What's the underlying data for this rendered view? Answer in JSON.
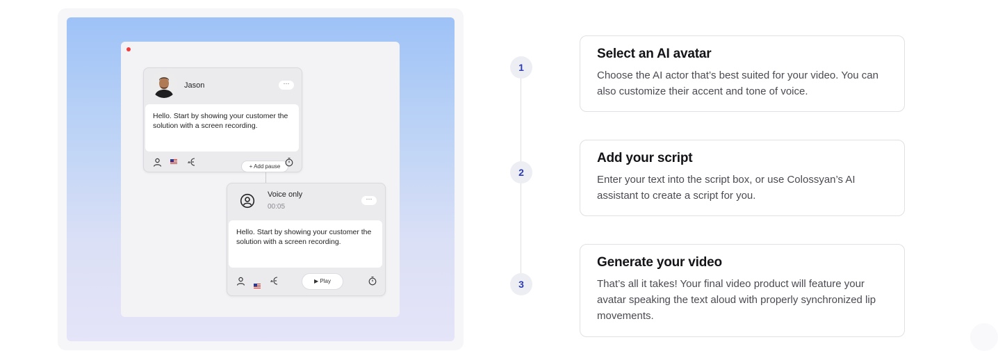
{
  "illustration": {
    "card1": {
      "name": "Jason",
      "menu_label": "···",
      "script_text": "Hello. Start by showing your customer the solution with a screen recording.",
      "add_pause_label": "+ Add pause"
    },
    "card2": {
      "name": "Voice only",
      "time": "00:05",
      "menu_label": "···",
      "script_text": "Hello. Start by showing your customer the solution with a screen recording.",
      "play_label": "▶ Play"
    },
    "icons": {
      "person": "person-icon",
      "flag": "us-flag-icon",
      "voice": "voice-icon",
      "timer": "timer-icon"
    }
  },
  "steps": [
    {
      "number": "1",
      "title": "Select an AI avatar",
      "description": "Choose the AI actor that’s best suited for your video. You can also customize their accent and tone of voice."
    },
    {
      "number": "2",
      "title": "Add your script",
      "description": "Enter your text into the script box, or use Colossyan’s AI assistant to create a script for you."
    },
    {
      "number": "3",
      "title": "Generate your video",
      "description": "That’s all it takes! Your final video product will feature your avatar speaking the text aloud with properly synchronized lip movements."
    }
  ],
  "colors": {
    "accent": "#2b3ab5",
    "record_dot": "#ef3b3b",
    "gradient_top": "#9ec2f7",
    "gradient_bottom": "#e5e4f8"
  }
}
